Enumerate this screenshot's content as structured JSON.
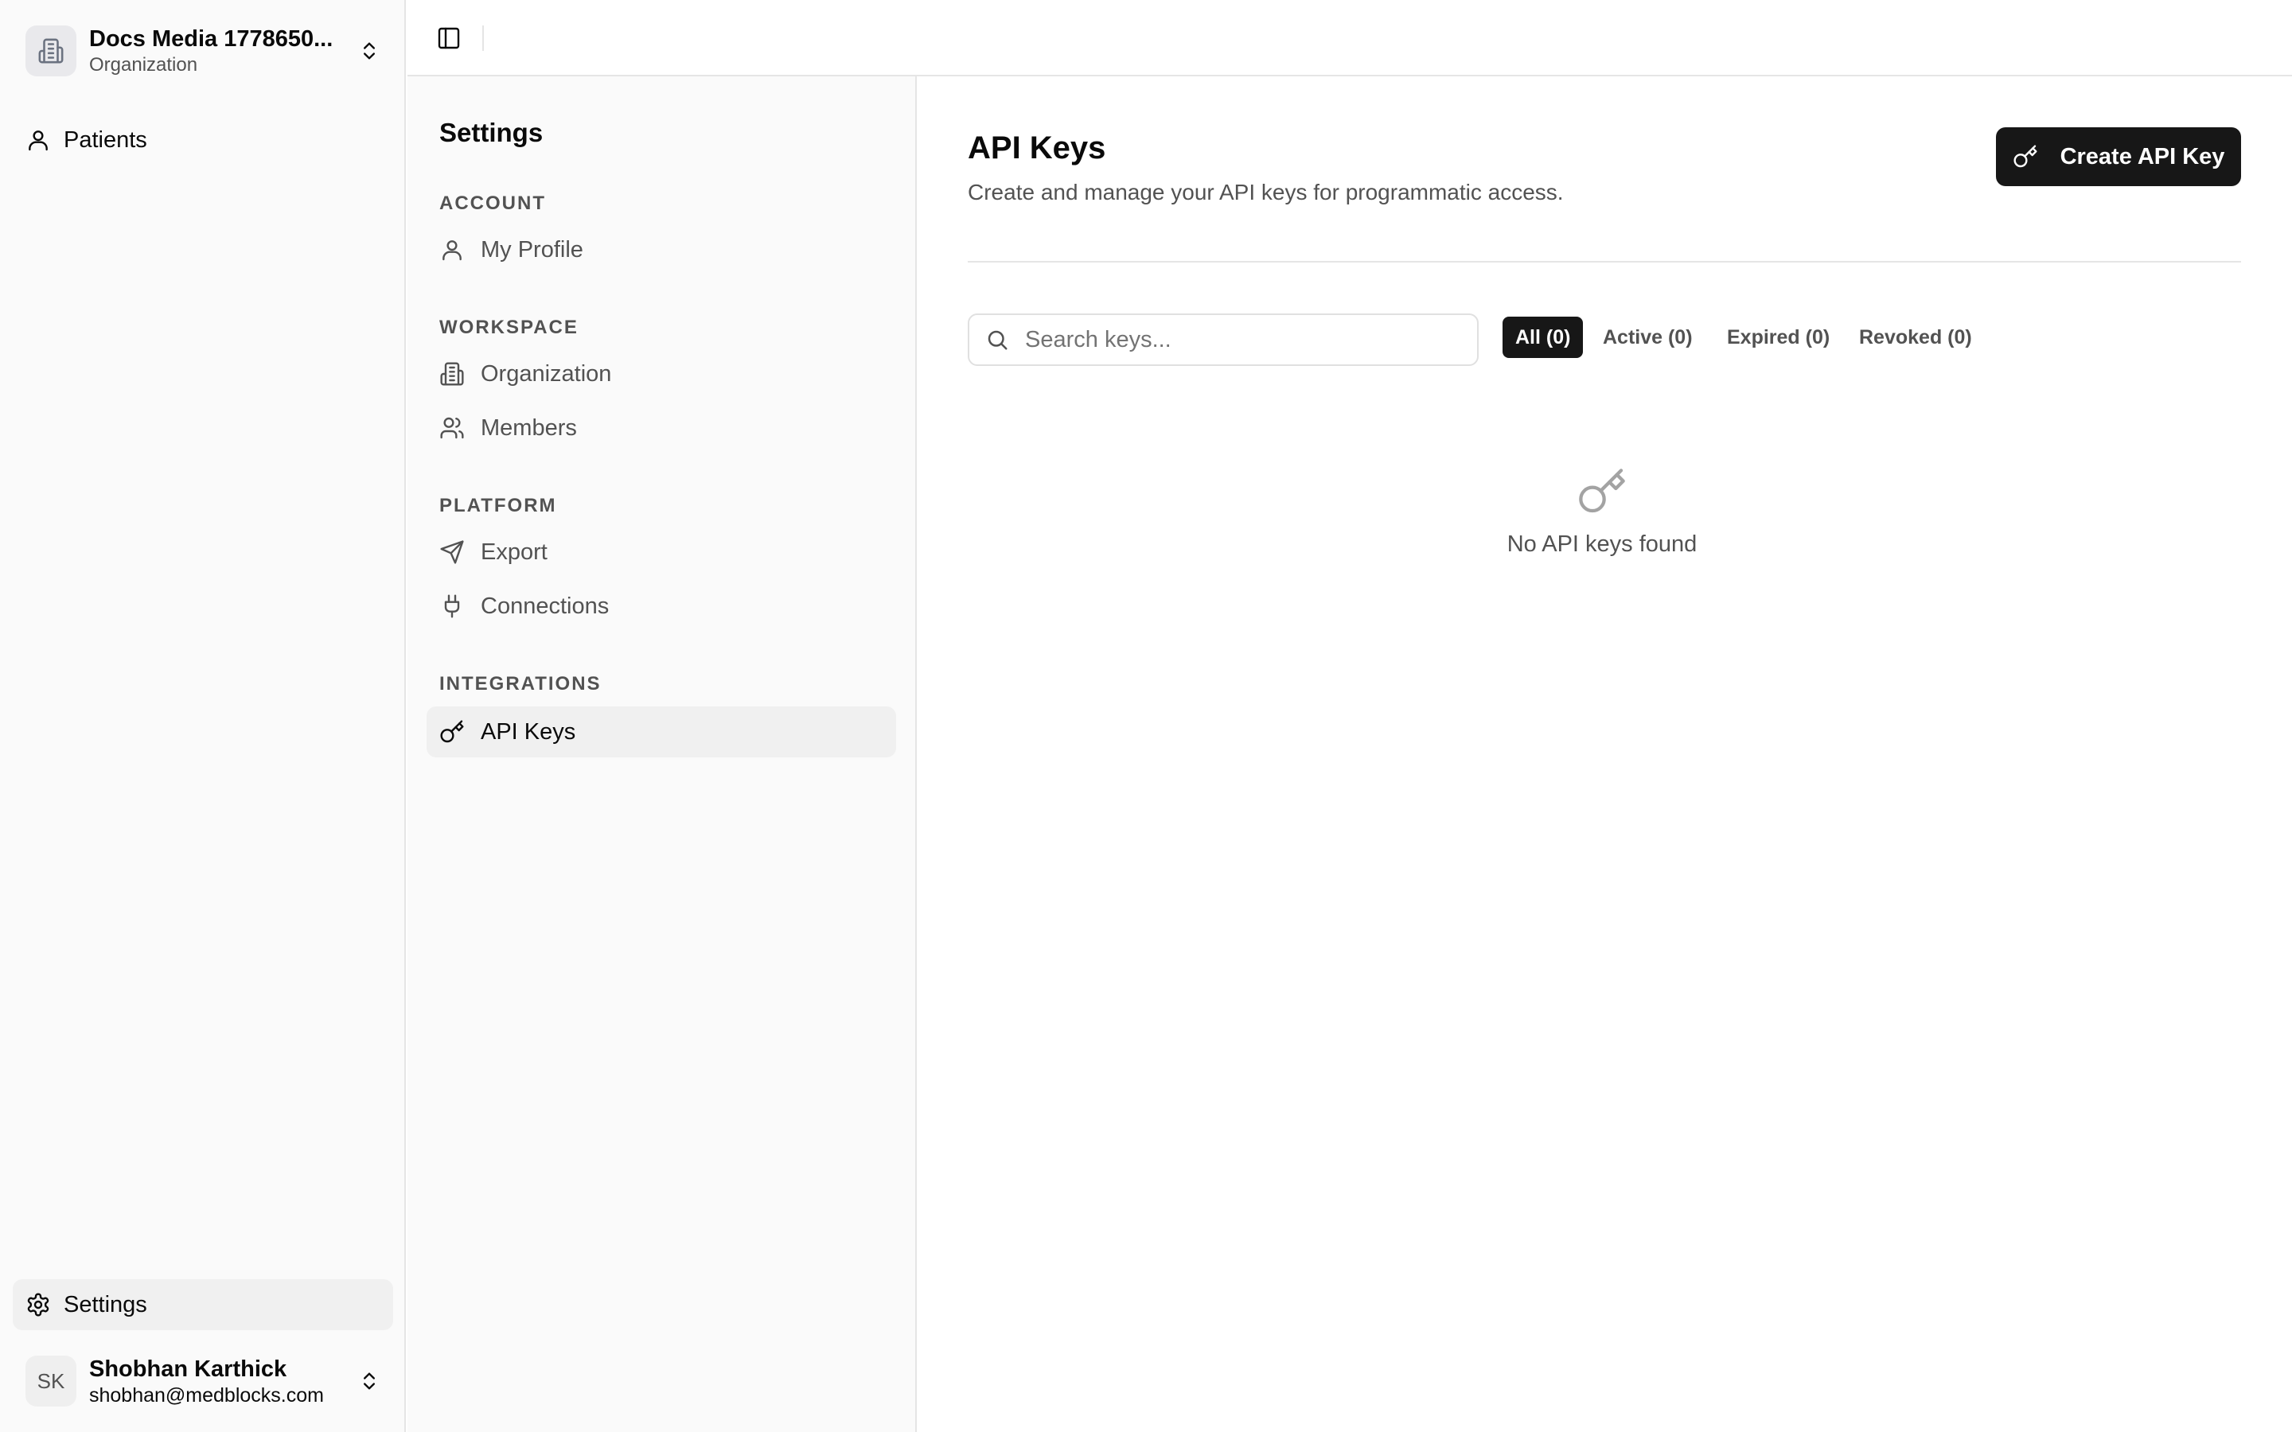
{
  "org": {
    "name": "Docs Media 1778650...",
    "subtitle": "Organization"
  },
  "app_nav": {
    "patients": "Patients",
    "settings": "Settings"
  },
  "user": {
    "initials": "SK",
    "name": "Shobhan Karthick",
    "email": "shobhan@medblocks.com"
  },
  "settings_nav": {
    "title": "Settings",
    "sections": {
      "account": "ACCOUNT",
      "workspace": "WORKSPACE",
      "platform": "PLATFORM",
      "integrations": "INTEGRATIONS"
    },
    "items": {
      "my_profile": "My Profile",
      "organization": "Organization",
      "members": "Members",
      "export": "Export",
      "connections": "Connections",
      "api_keys": "API Keys"
    },
    "active": "API Keys"
  },
  "main": {
    "title": "API Keys",
    "description": "Create and manage your API keys for programmatic access.",
    "create_button": "Create API Key",
    "search_placeholder": "Search keys...",
    "search_value": "",
    "tabs": {
      "all": "All (0)",
      "active": "Active (0)",
      "expired": "Expired (0)",
      "revoked": "Revoked (0)"
    },
    "selected_tab": "All (0)",
    "empty_message": "No API keys found"
  },
  "icons": {
    "org": "building-icon",
    "patients": "user-icon",
    "settings": "gear-icon",
    "toggle": "sidebar-toggle-icon",
    "key": "key-icon",
    "search": "search-icon"
  },
  "colors": {
    "primary_button": "#171717",
    "sidebar_bg": "#fafafa",
    "active_item_bg": "#f0f0f0"
  }
}
